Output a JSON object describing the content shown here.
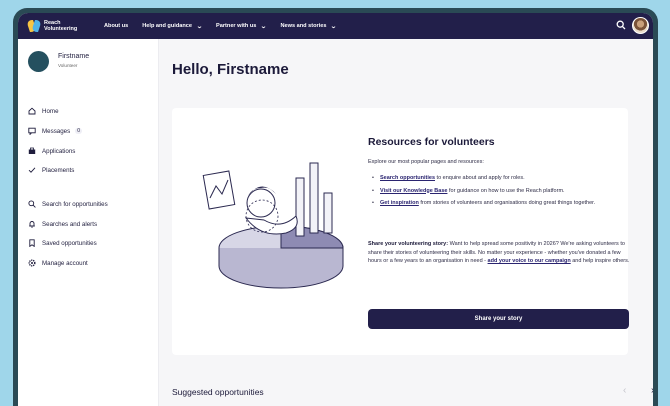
{
  "nav": {
    "logo_line1": "Reach",
    "logo_line2": "Volunteering",
    "links": [
      "About us",
      "Help and guidance",
      "Partner with us",
      "News and stories"
    ]
  },
  "sidebar": {
    "name": "Firstname",
    "role": "Volunteer",
    "items": [
      {
        "label": "Home",
        "icon": "home-icon"
      },
      {
        "label": "Messages",
        "icon": "message-icon",
        "badge": "0"
      },
      {
        "label": "Applications",
        "icon": "applications-icon"
      },
      {
        "label": "Placements",
        "icon": "check-icon"
      },
      {
        "label": "Search for opportunities",
        "icon": "search-icon"
      },
      {
        "label": "Searches and alerts",
        "icon": "bell-icon"
      },
      {
        "label": "Saved opportunities",
        "icon": "bookmark-icon"
      },
      {
        "label": "Manage account",
        "icon": "gear-icon"
      }
    ]
  },
  "main": {
    "greeting": "Hello, Firstname",
    "resources": {
      "title": "Resources for volunteers",
      "intro": "Explore our most popular pages and resources:",
      "items": [
        {
          "link": "Search opportunities",
          "text": " to enquire about and apply for roles."
        },
        {
          "link": "Visit our Knowledge Base",
          "text": " for guidance on how to use the Reach platform."
        },
        {
          "link": "Get inspiration",
          "text": " from stories of volunteers and organisations doing great things together."
        }
      ],
      "story_heading": "Share your volunteering story:",
      "story_text": " Want to help spread some positivity in 2026? We're asking volunteers to share their stories of volunteering their skills. No matter your experience - whether you've donated a few hours or a few years to an organisation in need - ",
      "story_link": "add your voice to our campaign",
      "story_end": " and help inspire others.",
      "button": "Share your story"
    },
    "suggested_title": "Suggested opportunities"
  },
  "colors": {
    "navy": "#221f4a",
    "accent_yellow": "#f6c544",
    "accent_blue": "#4fb3e8",
    "frame": "#2a4a55",
    "background": "#9fd6ea"
  }
}
